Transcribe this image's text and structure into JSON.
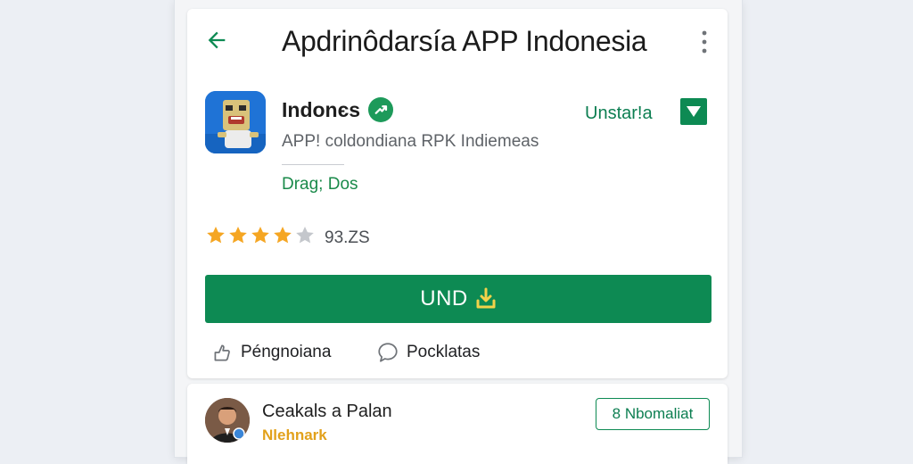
{
  "header": {
    "back_icon": "arrow-left-icon",
    "title": "Apdrinôdarsía APP Indonesia",
    "more_icon": "more-vert-icon"
  },
  "app": {
    "icon": "app-icon",
    "name": "Indonєs",
    "verified_icon": "verified-badge-icon",
    "subtitle": "APP! coldondiana RPK Indiemeas",
    "category": "Drag; Dos",
    "install_link": "Unstar!a",
    "install_toggle_icon": "dropdown-checkbox-icon",
    "rating": {
      "stars_filled": 4,
      "stars_total": 5,
      "text": "93.ZS"
    }
  },
  "primary_button": {
    "label": "UND",
    "icon": "download-icon"
  },
  "actions": [
    {
      "label": "Péngnoiana",
      "icon": "share-icon"
    },
    {
      "label": "Pocklatas",
      "icon": "comment-icon"
    }
  ],
  "review": {
    "avatar": "avatar",
    "name": "Ceakals a Palan",
    "tag": "Nlehnark",
    "button_label": "8 Nbomaliat"
  },
  "colors": {
    "accent_green": "#0d8a53",
    "star_yellow": "#f5a623",
    "star_gray": "#c4c7cc",
    "background": "#eceff4",
    "tag_orange": "#e2a11b"
  }
}
